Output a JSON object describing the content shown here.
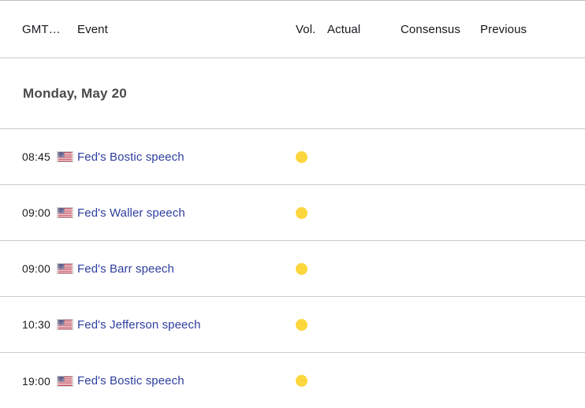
{
  "table": {
    "columns": {
      "time": "GMT…",
      "event": "Event",
      "volatility": "Vol.",
      "actual": "Actual",
      "consensus": "Consensus",
      "previous": "Previous"
    },
    "date_group": "Monday, May 20",
    "rows": [
      {
        "time": "08:45",
        "country": "united-states-flag-icon",
        "event": "Fed's Bostic speech",
        "volatility": "moderate",
        "actual": "",
        "consensus": "",
        "previous": ""
      },
      {
        "time": "09:00",
        "country": "united-states-flag-icon",
        "event": "Fed's Waller speech",
        "volatility": "moderate",
        "actual": "",
        "consensus": "",
        "previous": ""
      },
      {
        "time": "09:00",
        "country": "united-states-flag-icon",
        "event": "Fed's Barr speech",
        "volatility": "moderate",
        "actual": "",
        "consensus": "",
        "previous": ""
      },
      {
        "time": "10:30",
        "country": "united-states-flag-icon",
        "event": "Fed's Jefferson speech",
        "volatility": "moderate",
        "actual": "",
        "consensus": "",
        "previous": ""
      },
      {
        "time": "19:00",
        "country": "united-states-flag-icon",
        "event": "Fed's Bostic speech",
        "volatility": "moderate",
        "actual": "",
        "consensus": "",
        "previous": ""
      }
    ]
  },
  "colors": {
    "event_link": "#2e3f9e",
    "volatility_moderate": "#fbd63d",
    "divider": "#c5ccd1",
    "date_text": "#4a4a4a",
    "text": "#1b1b1b"
  }
}
